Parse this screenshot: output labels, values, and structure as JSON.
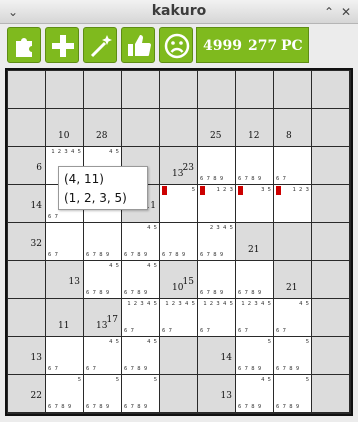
{
  "window": {
    "title": "kakuro"
  },
  "toolbar": {
    "buttons": [
      {
        "name": "puzzle-button",
        "icon": "puzzle-icon"
      },
      {
        "name": "add-button",
        "icon": "plus-icon"
      },
      {
        "name": "hint-button",
        "icon": "magic-wand-icon"
      },
      {
        "name": "approve-button",
        "icon": "thumbs-up-icon"
      },
      {
        "name": "give-up-button",
        "icon": "sad-face-icon"
      }
    ],
    "accent": "#7fba1e"
  },
  "status": {
    "puzzle_number": "4999",
    "count": "277",
    "mode": "PC"
  },
  "board": {
    "rows": [
      [
        {
          "t": "b"
        },
        {
          "t": "b"
        },
        {
          "t": "b"
        },
        {
          "t": "b"
        },
        {
          "t": "b"
        },
        {
          "t": "b"
        },
        {
          "t": "b"
        },
        {
          "t": "b"
        },
        {
          "t": "b"
        }
      ],
      [
        {
          "t": "b"
        },
        {
          "t": "c",
          "down": "10"
        },
        {
          "t": "c",
          "down": "28"
        },
        {
          "t": "b"
        },
        {
          "t": "b"
        },
        {
          "t": "c",
          "down": "25"
        },
        {
          "t": "c",
          "down": "12"
        },
        {
          "t": "c",
          "down": "8"
        },
        {
          "t": "b"
        }
      ],
      [
        {
          "t": "c",
          "across": "6"
        },
        {
          "t": "w",
          "top": "1 2 3 4 5"
        },
        {
          "t": "w",
          "top": "4 5"
        },
        {
          "t": "b"
        },
        {
          "t": "c",
          "down": "13",
          "across": "23"
        },
        {
          "t": "w",
          "bot": "6 7 8 9"
        },
        {
          "t": "w",
          "bot": "6 7 8 9"
        },
        {
          "t": "w",
          "bot": "6 7"
        },
        {
          "t": "b"
        }
      ],
      [
        {
          "t": "c",
          "across": "14"
        },
        {
          "t": "w",
          "top": "5",
          "bot": "6 7"
        },
        {
          "t": "w",
          "top": "5"
        },
        {
          "t": "c",
          "across": "11"
        },
        {
          "t": "w",
          "top": "5",
          "red": true
        },
        {
          "t": "w",
          "top": "1 2 3",
          "red": true
        },
        {
          "t": "w",
          "top": "3 5",
          "red": true
        },
        {
          "t": "w",
          "top": "1 2 3",
          "red": true
        },
        {
          "t": "b"
        }
      ],
      [
        {
          "t": "c",
          "across": "32"
        },
        {
          "t": "w",
          "bot": "6 7"
        },
        {
          "t": "w",
          "bot": "6 7 8 9"
        },
        {
          "t": "w",
          "top": "4 5",
          "bot": "6 7 8 9"
        },
        {
          "t": "w",
          "bot": "6 7 8 9"
        },
        {
          "t": "w",
          "top": "2 3 4 5",
          "bot": "6 7 8 9"
        },
        {
          "t": "c",
          "down": "21"
        },
        {
          "t": "b"
        },
        {
          "t": "b"
        }
      ],
      [
        {
          "t": "b"
        },
        {
          "t": "c",
          "across": "13"
        },
        {
          "t": "w",
          "top": "4 5",
          "bot": "6 7 8 9"
        },
        {
          "t": "w",
          "top": "4 5",
          "bot": "6 7 8 9"
        },
        {
          "t": "c",
          "down": "10",
          "across": "15"
        },
        {
          "t": "w",
          "bot": "6 7 8 9"
        },
        {
          "t": "w",
          "bot": "6 7 8 9"
        },
        {
          "t": "c",
          "down": "21"
        },
        {
          "t": "b"
        }
      ],
      [
        {
          "t": "b"
        },
        {
          "t": "c",
          "down": "11"
        },
        {
          "t": "c",
          "down": "13",
          "across": "17"
        },
        {
          "t": "w",
          "top": "1 2 3 4 5",
          "bot": "6 7"
        },
        {
          "t": "w",
          "top": "1 2 3 4 5",
          "bot": "6 7"
        },
        {
          "t": "w",
          "top": "1 2 3 4 5",
          "bot": "6 7"
        },
        {
          "t": "w",
          "top": "1 2 3 4 5",
          "bot": "6 7"
        },
        {
          "t": "w",
          "top": "4 5",
          "bot": "6 7"
        },
        {
          "t": "b"
        }
      ],
      [
        {
          "t": "c",
          "across": "13"
        },
        {
          "t": "w",
          "bot": "6 7"
        },
        {
          "t": "w",
          "top": "4 5",
          "bot": "6 7"
        },
        {
          "t": "w",
          "top": "4 5",
          "bot": "6 7 8 9"
        },
        {
          "t": "b"
        },
        {
          "t": "c",
          "across": "14"
        },
        {
          "t": "w",
          "top": "5",
          "bot": "6 7 8 9"
        },
        {
          "t": "w",
          "top": "5",
          "bot": "6 7 8 9"
        },
        {
          "t": "b"
        }
      ],
      [
        {
          "t": "c",
          "across": "22"
        },
        {
          "t": "w",
          "top": "5",
          "bot": "6 7 8 9"
        },
        {
          "t": "w",
          "top": "5",
          "bot": "6 7 8 9"
        },
        {
          "t": "w",
          "top": "5",
          "bot": "6 7 8 9"
        },
        {
          "t": "b"
        },
        {
          "t": "c",
          "across": "13"
        },
        {
          "t": "w",
          "top": "4 5",
          "bot": "6 7 8 9"
        },
        {
          "t": "w",
          "top": "5",
          "bot": "6 7 8 9"
        },
        {
          "t": "b"
        }
      ]
    ]
  },
  "tooltip": {
    "line1": "(4, 11)",
    "line2": "(1, 2, 3, 5)"
  }
}
